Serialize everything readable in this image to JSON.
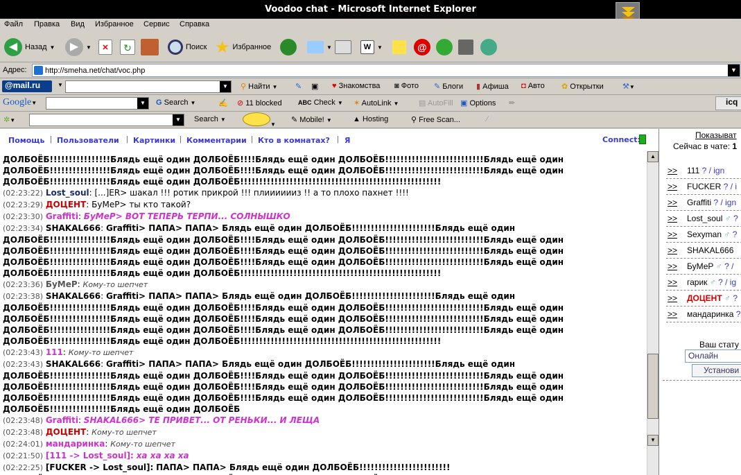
{
  "window": {
    "title": "Voodoo chat - Microsoft Internet Explorer"
  },
  "menu": [
    "Файл",
    "Правка",
    "Вид",
    "Избранное",
    "Сервис",
    "Справка"
  ],
  "toolbar": {
    "back": "Назад",
    "search": "Поиск",
    "favorites": "Избранное"
  },
  "address": {
    "label": "Адрес:",
    "url": "http://smeha.net/chat/voc.php"
  },
  "mailbar": {
    "logo": "@mail.ru",
    "find": "Найти",
    "items": [
      "Знакомства",
      "Фото",
      "Блоги",
      "Афиша",
      "Авто",
      "Открытки"
    ]
  },
  "googlebar": {
    "logo": "Google",
    "search": "Search",
    "blocked": "11 blocked",
    "check": "Check",
    "autolink": "AutoLink",
    "autofill": "AutoFill",
    "options": "Options",
    "icq": "icq"
  },
  "yahoobar": {
    "search": "Search",
    "mobile": "Mobile!",
    "hosting": "Hosting",
    "freescan": "Free Scan..."
  },
  "nav": {
    "links": [
      "Помощь",
      "Пользователи",
      "Картинки",
      "Комментарии",
      "Кто в комнатах?",
      "Я"
    ],
    "connect": "Connect:"
  },
  "messages": [
    {
      "ts": "",
      "name": "",
      "text": "ДОЛБОЁБ!!!!!!!!!!!!!!!!Блядь ещё один ДОЛБОЁБ!!!!Блядь ещё один ДОЛБОЁБ!!!!!!!!!!!!!!!!!!!!!!!!!!Блядь ещё один",
      "type": "spam",
      "color": "#000"
    },
    {
      "ts": "",
      "name": "",
      "text": "ДОЛБОЁБ!!!!!!!!!!!!!!!!Блядь ещё один ДОЛБОЁБ!!!!Блядь ещё один ДОЛБОЁБ!!!!!!!!!!!!!!!!!!!!!!!!!!Блядь ещё один",
      "type": "spam",
      "color": "#000"
    },
    {
      "ts": "",
      "name": "",
      "text": "ДОЛБОЁБ!!!!!!!!!!!!!!!!Блядь ещё один ДОЛБОЁБ!!!!!!!!!!!!!!!!!!!!!!!!!!!!!!!!!!!!!!!!!!!!!!!!!!!!!",
      "type": "spam",
      "color": "#000"
    },
    {
      "ts": "(02:23:22)",
      "name": "Lost_soul",
      "text": "[...]ER> шакал !!! ротик прикрой !!! плииииииз !! а то плохо пахнет !!!!",
      "type": "plain",
      "color": "#1a2a6a"
    },
    {
      "ts": "(02:23:29)",
      "name": "ДОЦЕНТ",
      "text": "БуМеР> ты кто такой?",
      "type": "plain",
      "color": "#d00000"
    },
    {
      "ts": "(02:23:30)",
      "name": "Graffiti",
      "text": "БуМеР> ВОТ ТЕПЕРЬ ТЕРПИ... СОЛНЫШКО",
      "type": "pm",
      "color": "#cc33cc"
    },
    {
      "ts": "(02:23:34)",
      "name": "SHAKAL666",
      "text": "Graffiti> ПАПА> ПАПА> Блядь ещё один ДОЛБОЁБ!!!!!!!!!!!!!!!!!!!!!!Блядь ещё один",
      "type": "spam",
      "color": "#000"
    },
    {
      "ts": "",
      "name": "",
      "text": "ДОЛБОЁБ!!!!!!!!!!!!!!!!Блядь ещё один ДОЛБОЁБ!!!!Блядь ещё один ДОЛБОЁБ!!!!!!!!!!!!!!!!!!!!!!!!!!Блядь ещё один",
      "type": "spam",
      "color": "#000"
    },
    {
      "ts": "",
      "name": "",
      "text": "ДОЛБОЁБ!!!!!!!!!!!!!!!!Блядь ещё один ДОЛБОЁБ!!!!Блядь ещё один ДОЛБОЁБ!!!!!!!!!!!!!!!!!!!!!!!!!!Блядь ещё один",
      "type": "spam",
      "color": "#000"
    },
    {
      "ts": "",
      "name": "",
      "text": "ДОЛБОЁБ!!!!!!!!!!!!!!!!Блядь ещё один ДОЛБОЁБ!!!!Блядь ещё один ДОЛБОЁБ!!!!!!!!!!!!!!!!!!!!!!!!!!Блядь ещё один",
      "type": "spam",
      "color": "#000"
    },
    {
      "ts": "",
      "name": "",
      "text": "ДОЛБОЁБ!!!!!!!!!!!!!!!!Блядь ещё один ДОЛБОЁБ!!!!!!!!!!!!!!!!!!!!!!!!!!!!!!!!!!!!!!!!!!!!!!!!!!!!!",
      "type": "spam",
      "color": "#000"
    },
    {
      "ts": "(02:23:36)",
      "name": "БуМеР",
      "text": "Кому-то шепчет",
      "type": "whisper",
      "color": "#555"
    },
    {
      "ts": "(02:23:38)",
      "name": "SHAKAL666",
      "text": "Graffiti> ПАПА> ПАПА> Блядь ещё один ДОЛБОЁБ!!!!!!!!!!!!!!!!!!!!!!Блядь ещё один",
      "type": "spam",
      "color": "#000"
    },
    {
      "ts": "",
      "name": "",
      "text": "ДОЛБОЁБ!!!!!!!!!!!!!!!!Блядь ещё один ДОЛБОЁБ!!!!Блядь ещё один ДОЛБОЁБ!!!!!!!!!!!!!!!!!!!!!!!!!!Блядь ещё один",
      "type": "spam",
      "color": "#000"
    },
    {
      "ts": "",
      "name": "",
      "text": "ДОЛБОЁБ!!!!!!!!!!!!!!!!Блядь ещё один ДОЛБОЁБ!!!!Блядь ещё один ДОЛБОЁБ!!!!!!!!!!!!!!!!!!!!!!!!!!Блядь ещё один",
      "type": "spam",
      "color": "#000"
    },
    {
      "ts": "",
      "name": "",
      "text": "ДОЛБОЁБ!!!!!!!!!!!!!!!!Блядь ещё один ДОЛБОЁБ!!!!Блядь ещё один ДОЛБОЁБ!!!!!!!!!!!!!!!!!!!!!!!!!!Блядь ещё один",
      "type": "spam",
      "color": "#000"
    },
    {
      "ts": "",
      "name": "",
      "text": "ДОЛБОЁБ!!!!!!!!!!!!!!!!Блядь ещё один ДОЛБОЁБ!!!!!!!!!!!!!!!!!!!!!!!!!!!!!!!!!!!!!!!!!!!!!!!!!!!!!",
      "type": "spam",
      "color": "#000"
    },
    {
      "ts": "(02:23:43)",
      "name": "111",
      "text": "Кому-то шепчет",
      "type": "whisper",
      "color": "#cc33cc"
    },
    {
      "ts": "(02:23:43)",
      "name": "SHAKAL666",
      "text": "Graffiti> ПАПА> ПАПА> Блядь ещё один ДОЛБОЁБ!!!!!!!!!!!!!!!!!!!!!!Блядь ещё один",
      "type": "spam",
      "color": "#000"
    },
    {
      "ts": "",
      "name": "",
      "text": "ДОЛБОЁБ!!!!!!!!!!!!!!!!Блядь ещё один ДОЛБОЁБ!!!!Блядь ещё один ДОЛБОЁБ!!!!!!!!!!!!!!!!!!!!!!!!!!Блядь ещё один",
      "type": "spam",
      "color": "#000"
    },
    {
      "ts": "",
      "name": "",
      "text": "ДОЛБОЁБ!!!!!!!!!!!!!!!!Блядь ещё один ДОЛБОЁБ!!!!Блядь ещё один ДОЛБОЁБ!!!!!!!!!!!!!!!!!!!!!!!!!!Блядь ещё один",
      "type": "spam",
      "color": "#000"
    },
    {
      "ts": "",
      "name": "",
      "text": "ДОЛБОЁБ!!!!!!!!!!!!!!!!Блядь ещё один ДОЛБОЁБ!!!!Блядь ещё один ДОЛБОЁБ!!!!!!!!!!!!!!!!!!!!!!!!!!Блядь ещё один",
      "type": "spam",
      "color": "#000"
    },
    {
      "ts": "",
      "name": "",
      "text": "ДОЛБОЁБ!!!!!!!!!!!!!!!!Блядь ещё один ДОЛБОЁБ",
      "type": "spam",
      "color": "#000"
    },
    {
      "ts": "(02:23:48)",
      "name": "Graffiti",
      "text": "SHAKAL666> ТЕ ПРИВЕТ... ОТ РЕНЬКИ... И ЛЕЩА",
      "type": "pm",
      "color": "#cc33cc"
    },
    {
      "ts": "(02:23:48)",
      "name": "ДОЦЕНТ",
      "text": "Кому-то шепчет",
      "type": "whisper",
      "color": "#d00000"
    },
    {
      "ts": "(02:24:01)",
      "name": "мандаринка",
      "text": "Кому-то шепчет",
      "type": "whisper",
      "color": "#cc33cc"
    },
    {
      "ts": "(02:21:50)",
      "name": "[111 -> Lost_soul]:",
      "text": "ха ха ха ха",
      "type": "pm",
      "color": "#cc33cc"
    },
    {
      "ts": "(02:22:25)",
      "name": "[FUCKER -> Lost_soul]:",
      "text": "ПАПА> ПАПА> Блядь ещё один ДОЛБОЁБ!!!!!!!!!!!!!!!!!!!!!!!!",
      "type": "spam",
      "color": "#000"
    },
    {
      "ts": "",
      "name": "",
      "text": "ДОЛБОЁБ!!!!!!!!!!!!!!!!Блядь ещё один ДОЛБОЁБ!!!!Блядь ещё один ДОЛБОЁБ!!!!!!!!!!!!!!!!!!!!!!!!!!Блядь ещё один",
      "type": "spam",
      "color": "#000"
    }
  ],
  "sidebar": {
    "show": "Показыват",
    "now_label": "Сейчас в чате:",
    "now_count": "1",
    "users": [
      {
        "name": "111",
        "sex": "",
        "marks": "? / ign",
        "color": "#000"
      },
      {
        "name": "FUCKER",
        "sex": "",
        "marks": "? / i",
        "color": "#000"
      },
      {
        "name": "Graffiti",
        "sex": "",
        "marks": "? / ign",
        "color": "#000"
      },
      {
        "name": "Lost_soul",
        "sex": "♂",
        "marks": "?",
        "color": "#000"
      },
      {
        "name": "Sexyman",
        "sex": "♂",
        "marks": "?",
        "color": "#000"
      },
      {
        "name": "SHAKAL666",
        "sex": "",
        "marks": "",
        "color": "#000"
      },
      {
        "name": "БуМеР",
        "sex": "♂",
        "marks": "? /",
        "color": "#000"
      },
      {
        "name": "гарик",
        "sex": "♂",
        "marks": "? / ig",
        "color": "#000"
      },
      {
        "name": "ДОЦЕНТ",
        "sex": "♂",
        "marks": "?",
        "color": "#d00000"
      },
      {
        "name": "мандаринка",
        "sex": "",
        "marks": "?",
        "color": "#000"
      }
    ],
    "status_label": "Ваш стату",
    "status_value": "Онлайн",
    "status_button": "Установи"
  }
}
